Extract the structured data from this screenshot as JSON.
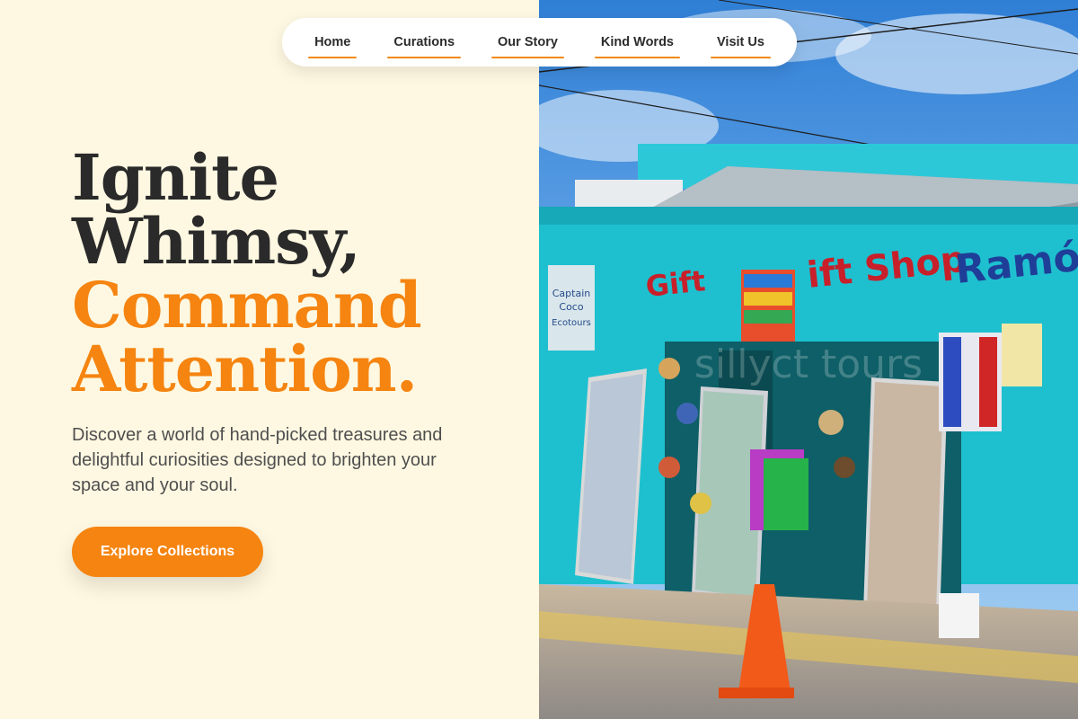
{
  "nav": {
    "items": [
      {
        "label": "Home"
      },
      {
        "label": "Curations"
      },
      {
        "label": "Our Story"
      },
      {
        "label": "Kind Words"
      },
      {
        "label": "Visit Us"
      }
    ]
  },
  "hero": {
    "headline_dark_1": "Ignite",
    "headline_dark_2": "Whimsy,",
    "headline_accent_1": "Command",
    "headline_accent_2": "Attention.",
    "subtext": "Discover a world of hand-picked treasures and delightful curiosities designed to brighten your space and your soul.",
    "cta_label": "Explore Collections"
  },
  "photo": {
    "sign_text": "Gift Shop",
    "sign_text_2": "Ramón",
    "plaque_text": "Captain Coco Ecotours",
    "watermark": "sillyct tours"
  },
  "colors": {
    "background": "#fef8e2",
    "accent": "#f58410",
    "text_dark": "#2a2a2a",
    "text_body": "#4f4f4f"
  }
}
